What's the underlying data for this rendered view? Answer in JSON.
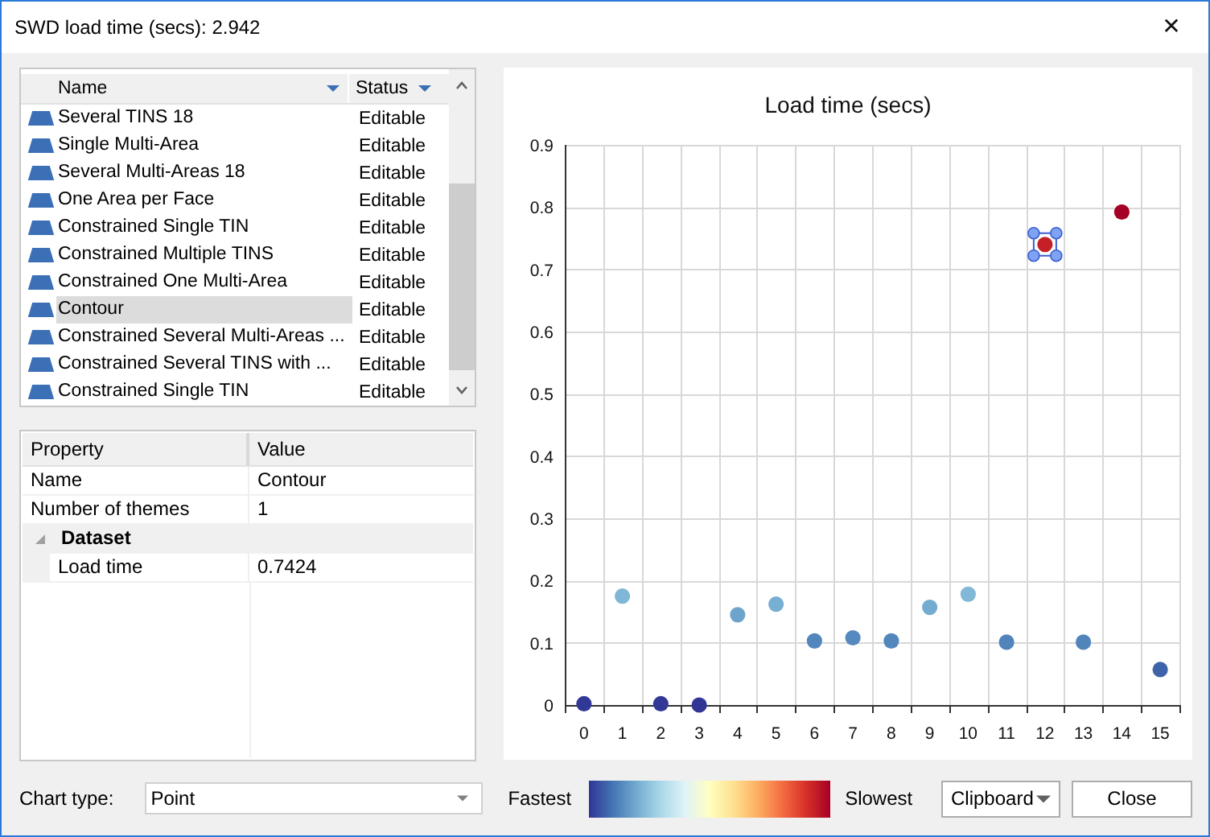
{
  "window": {
    "title": "SWD load time (secs): 2.942",
    "close": "✕"
  },
  "themes_list": {
    "columns": [
      {
        "label": "Name"
      },
      {
        "label": "Status"
      }
    ],
    "rows": [
      {
        "name": "Several TINS 18",
        "status": "Editable",
        "selected": false
      },
      {
        "name": "Single Multi-Area",
        "status": "Editable",
        "selected": false
      },
      {
        "name": "Several Multi-Areas 18",
        "status": "Editable",
        "selected": false
      },
      {
        "name": "One Area per Face",
        "status": "Editable",
        "selected": false
      },
      {
        "name": "Constrained Single TIN",
        "status": "Editable",
        "selected": false
      },
      {
        "name": "Constrained Multiple TINS",
        "status": "Editable",
        "selected": false
      },
      {
        "name": "Constrained One Multi-Area",
        "status": "Editable",
        "selected": false
      },
      {
        "name": "Contour",
        "status": "Editable",
        "selected": true
      },
      {
        "name": "Constrained Several Multi-Areas ...",
        "status": "Editable",
        "selected": false
      },
      {
        "name": "Constrained Several TINS with ...",
        "status": "Editable",
        "selected": false
      },
      {
        "name": "Constrained Single TIN",
        "status": "Editable",
        "selected": false
      }
    ]
  },
  "property_grid": {
    "columns": [
      "Property",
      "Value"
    ],
    "rows": [
      {
        "kind": "property",
        "property": "Name",
        "value": "Contour"
      },
      {
        "kind": "property",
        "property": "Number of themes",
        "value": "1"
      },
      {
        "kind": "category",
        "label": "Dataset",
        "expanded": true
      },
      {
        "kind": "child",
        "property": "Load time",
        "value": "0.7424"
      }
    ]
  },
  "chart": {
    "chart_data": {
      "type": "scatter",
      "title": "Load time (secs)",
      "x": [
        0,
        1,
        2,
        3,
        4,
        5,
        6,
        7,
        8,
        9,
        10,
        11,
        12,
        13,
        14,
        15
      ],
      "series": [
        {
          "values": [
            0.002,
            0.175,
            0.002,
            0.0,
            0.145,
            0.162,
            0.103,
            0.108,
            0.103,
            0.157,
            0.178,
            0.101,
            0.74,
            0.101,
            0.792,
            0.057
          ]
        }
      ],
      "xlim": [
        -0.5,
        15.5
      ],
      "ylim": [
        0,
        0.9
      ],
      "grid": true,
      "xticks": [
        0,
        1,
        2,
        3,
        4,
        5,
        6,
        7,
        8,
        9,
        10,
        11,
        12,
        13,
        14,
        15
      ],
      "yticks": [
        0,
        0.1,
        0.2,
        0.3,
        0.4,
        0.5,
        0.6,
        0.7,
        0.8,
        0.9
      ]
    },
    "points": [
      {
        "selected": false
      },
      {
        "selected": false
      },
      {
        "selected": false
      },
      {
        "selected": false
      },
      {
        "selected": false
      },
      {
        "selected": false
      },
      {
        "selected": false
      },
      {
        "selected": false
      },
      {
        "selected": false
      },
      {
        "selected": false
      },
      {
        "selected": false
      },
      {
        "selected": false
      },
      {
        "selected": true
      },
      {
        "selected": false
      },
      {
        "selected": false
      },
      {
        "selected": false
      }
    ]
  },
  "footer": {
    "chart_type_label": "Chart type:",
    "chart_type": "Point",
    "legend_low": "Fastest",
    "legend_high": "Slowest",
    "clipboard": "Clipboard",
    "close": "Close"
  }
}
